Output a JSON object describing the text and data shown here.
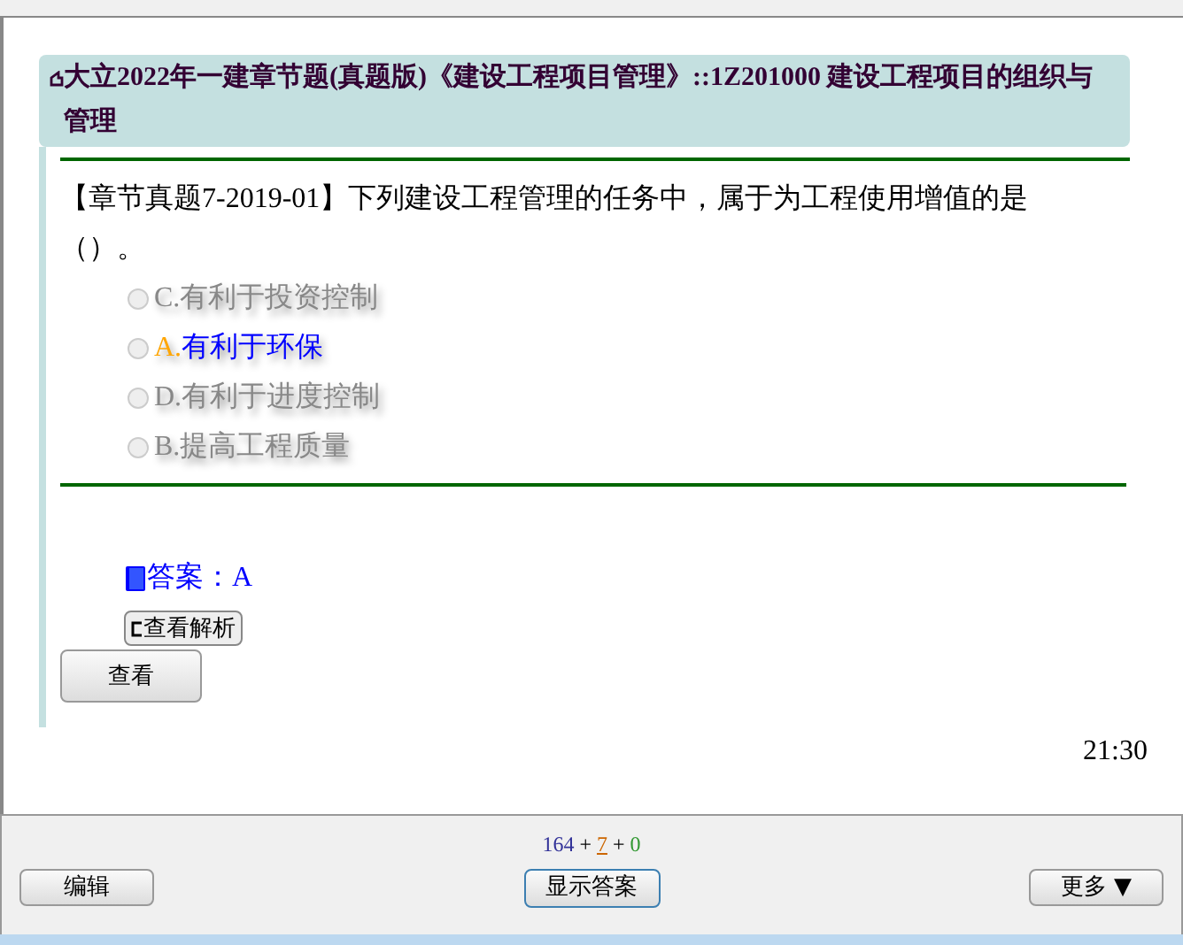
{
  "title": "大立2022年一建章节题(真题版)《建设工程项目管理》::1Z201000 建设工程项目的组织与管理",
  "question": {
    "tag": "【章节真题7-2019-01】",
    "text": "下列建设工程管理的任务中，属于为工程使用增值的是（）。"
  },
  "options": [
    {
      "letter": "C.",
      "text": "有利于投资控制",
      "selected": false,
      "checked": false
    },
    {
      "letter": "A.",
      "text": "有利于环保",
      "selected": true,
      "checked": false
    },
    {
      "letter": "D.",
      "text": "有利于进度控制",
      "selected": false,
      "checked": false
    },
    {
      "letter": "B.",
      "text": "提高工程质量",
      "selected": false,
      "checked": false
    }
  ],
  "answer": "答案：A",
  "analysis_button": "查看解析",
  "view_button": "查看",
  "time": "21:30",
  "counts": [
    {
      "value": "164",
      "color": "#333399",
      "underline": false
    },
    {
      "kind": "sign",
      "value": "+"
    },
    {
      "value": "7",
      "color": "#cc6600",
      "underline": true
    },
    {
      "kind": "sign",
      "value": "+"
    },
    {
      "value": "0",
      "color": "#339933",
      "underline": false
    }
  ],
  "footer_buttons": {
    "edit": "编辑",
    "show": "显示答案",
    "more": "更多 ▼"
  }
}
